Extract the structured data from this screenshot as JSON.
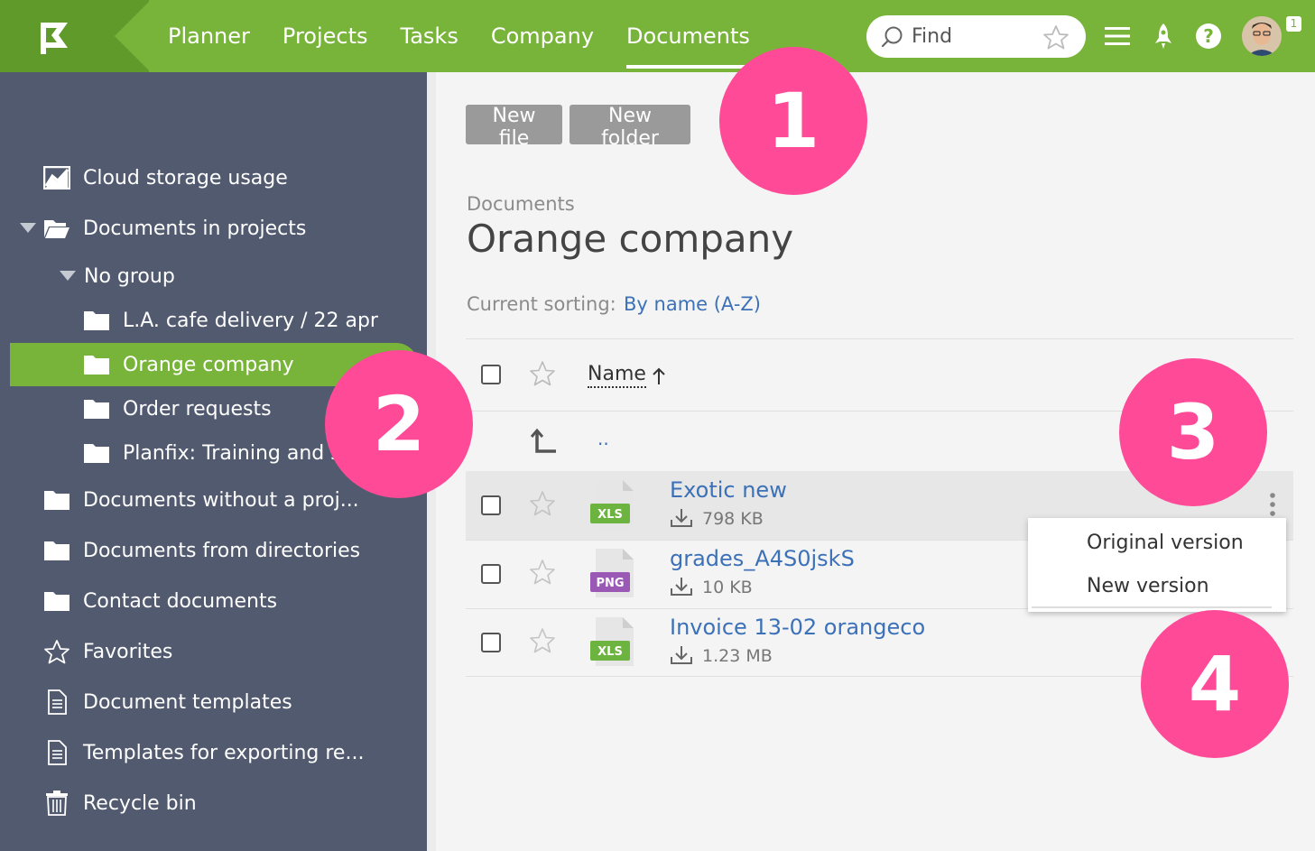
{
  "nav": {
    "items": [
      "Planner",
      "Projects",
      "Tasks",
      "Company",
      "Documents"
    ],
    "active_index": 4
  },
  "search": {
    "placeholder": "Find"
  },
  "header_icons": [
    "menu-icon",
    "rocket-icon",
    "help-icon"
  ],
  "notifications": {
    "count": "1"
  },
  "toolbar": {
    "new_file": "New file",
    "new_folder": "New folder"
  },
  "breadcrumb": "Documents",
  "page_title": "Orange company",
  "sorting": {
    "label": "Current sorting:",
    "value": "By name (A-Z)"
  },
  "sidebar": {
    "items": [
      {
        "label": "Cloud storage usage",
        "icon": "chart-icon"
      },
      {
        "label": "Documents in projects",
        "icon": "folder-open-icon"
      },
      {
        "label": "No group",
        "icon": ""
      },
      {
        "label": "L.A. cafe delivery / 22 apr",
        "icon": "folder-icon"
      },
      {
        "label": "Orange company",
        "icon": "folder-icon",
        "active": true
      },
      {
        "label": "Order requests",
        "icon": "folder-icon"
      },
      {
        "label": "Planfix: Training and su",
        "icon": "folder-icon"
      },
      {
        "label": "Documents without a proj...",
        "icon": "folder-icon"
      },
      {
        "label": "Documents from directories",
        "icon": "folder-icon"
      },
      {
        "label": "Contact documents",
        "icon": "folder-icon"
      },
      {
        "label": "Favorites",
        "icon": "star-icon"
      },
      {
        "label": "Document templates",
        "icon": "document-icon"
      },
      {
        "label": "Templates for exporting re...",
        "icon": "document-icon"
      },
      {
        "label": "Recycle bin",
        "icon": "trash-icon"
      }
    ]
  },
  "table": {
    "column_name": "Name",
    "parent_link": "..",
    "files": [
      {
        "name": "Exotic new",
        "size": "798 KB",
        "type": "XLS",
        "type_color": "#6cb33f"
      },
      {
        "name": "grades_A4S0jskS",
        "size": "10 KB",
        "type": "PNG",
        "type_color": "#9b59b6"
      },
      {
        "name": "Invoice 13-02 orangeco",
        "size": "1.23 MB",
        "type": "XLS",
        "type_color": "#6cb33f"
      }
    ]
  },
  "context_menu": {
    "items": [
      "Original version",
      "New version"
    ]
  },
  "callouts": [
    "1",
    "2",
    "3",
    "4"
  ],
  "colors": {
    "green": "#79b43a",
    "sidebar": "#525a6f",
    "accent_pink": "#ff4a98",
    "link": "#3c71b8"
  }
}
